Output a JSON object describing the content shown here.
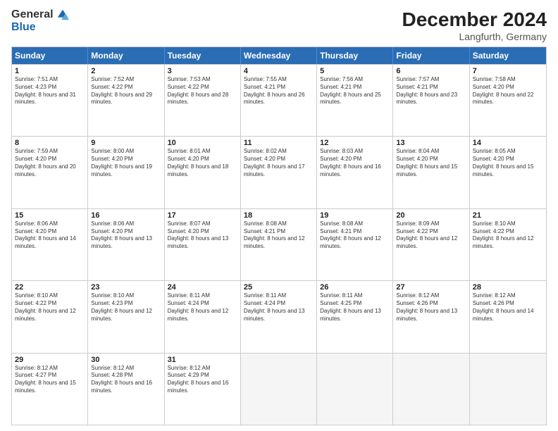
{
  "logo": {
    "general": "General",
    "blue": "Blue"
  },
  "title": "December 2024",
  "location": "Langfurth, Germany",
  "header_days": [
    "Sunday",
    "Monday",
    "Tuesday",
    "Wednesday",
    "Thursday",
    "Friday",
    "Saturday"
  ],
  "weeks": [
    [
      {
        "day": "1",
        "sunrise": "7:51 AM",
        "sunset": "4:23 PM",
        "daylight": "8 hours and 31 minutes."
      },
      {
        "day": "2",
        "sunrise": "7:52 AM",
        "sunset": "4:22 PM",
        "daylight": "8 hours and 29 minutes."
      },
      {
        "day": "3",
        "sunrise": "7:53 AM",
        "sunset": "4:22 PM",
        "daylight": "8 hours and 28 minutes."
      },
      {
        "day": "4",
        "sunrise": "7:55 AM",
        "sunset": "4:21 PM",
        "daylight": "8 hours and 26 minutes."
      },
      {
        "day": "5",
        "sunrise": "7:56 AM",
        "sunset": "4:21 PM",
        "daylight": "8 hours and 25 minutes."
      },
      {
        "day": "6",
        "sunrise": "7:57 AM",
        "sunset": "4:21 PM",
        "daylight": "8 hours and 23 minutes."
      },
      {
        "day": "7",
        "sunrise": "7:58 AM",
        "sunset": "4:20 PM",
        "daylight": "8 hours and 22 minutes."
      }
    ],
    [
      {
        "day": "8",
        "sunrise": "7:59 AM",
        "sunset": "4:20 PM",
        "daylight": "8 hours and 20 minutes."
      },
      {
        "day": "9",
        "sunrise": "8:00 AM",
        "sunset": "4:20 PM",
        "daylight": "8 hours and 19 minutes."
      },
      {
        "day": "10",
        "sunrise": "8:01 AM",
        "sunset": "4:20 PM",
        "daylight": "8 hours and 18 minutes."
      },
      {
        "day": "11",
        "sunrise": "8:02 AM",
        "sunset": "4:20 PM",
        "daylight": "8 hours and 17 minutes."
      },
      {
        "day": "12",
        "sunrise": "8:03 AM",
        "sunset": "4:20 PM",
        "daylight": "8 hours and 16 minutes."
      },
      {
        "day": "13",
        "sunrise": "8:04 AM",
        "sunset": "4:20 PM",
        "daylight": "8 hours and 15 minutes."
      },
      {
        "day": "14",
        "sunrise": "8:05 AM",
        "sunset": "4:20 PM",
        "daylight": "8 hours and 15 minutes."
      }
    ],
    [
      {
        "day": "15",
        "sunrise": "8:06 AM",
        "sunset": "4:20 PM",
        "daylight": "8 hours and 14 minutes."
      },
      {
        "day": "16",
        "sunrise": "8:06 AM",
        "sunset": "4:20 PM",
        "daylight": "8 hours and 13 minutes."
      },
      {
        "day": "17",
        "sunrise": "8:07 AM",
        "sunset": "4:20 PM",
        "daylight": "8 hours and 13 minutes."
      },
      {
        "day": "18",
        "sunrise": "8:08 AM",
        "sunset": "4:21 PM",
        "daylight": "8 hours and 12 minutes."
      },
      {
        "day": "19",
        "sunrise": "8:08 AM",
        "sunset": "4:21 PM",
        "daylight": "8 hours and 12 minutes."
      },
      {
        "day": "20",
        "sunrise": "8:09 AM",
        "sunset": "4:22 PM",
        "daylight": "8 hours and 12 minutes."
      },
      {
        "day": "21",
        "sunrise": "8:10 AM",
        "sunset": "4:22 PM",
        "daylight": "8 hours and 12 minutes."
      }
    ],
    [
      {
        "day": "22",
        "sunrise": "8:10 AM",
        "sunset": "4:22 PM",
        "daylight": "8 hours and 12 minutes."
      },
      {
        "day": "23",
        "sunrise": "8:10 AM",
        "sunset": "4:23 PM",
        "daylight": "8 hours and 12 minutes."
      },
      {
        "day": "24",
        "sunrise": "8:11 AM",
        "sunset": "4:24 PM",
        "daylight": "8 hours and 12 minutes."
      },
      {
        "day": "25",
        "sunrise": "8:11 AM",
        "sunset": "4:24 PM",
        "daylight": "8 hours and 13 minutes."
      },
      {
        "day": "26",
        "sunrise": "8:11 AM",
        "sunset": "4:25 PM",
        "daylight": "8 hours and 13 minutes."
      },
      {
        "day": "27",
        "sunrise": "8:12 AM",
        "sunset": "4:26 PM",
        "daylight": "8 hours and 13 minutes."
      },
      {
        "day": "28",
        "sunrise": "8:12 AM",
        "sunset": "4:26 PM",
        "daylight": "8 hours and 14 minutes."
      }
    ],
    [
      {
        "day": "29",
        "sunrise": "8:12 AM",
        "sunset": "4:27 PM",
        "daylight": "8 hours and 15 minutes."
      },
      {
        "day": "30",
        "sunrise": "8:12 AM",
        "sunset": "4:28 PM",
        "daylight": "8 hours and 16 minutes."
      },
      {
        "day": "31",
        "sunrise": "8:12 AM",
        "sunset": "4:29 PM",
        "daylight": "8 hours and 16 minutes."
      },
      null,
      null,
      null,
      null
    ]
  ]
}
